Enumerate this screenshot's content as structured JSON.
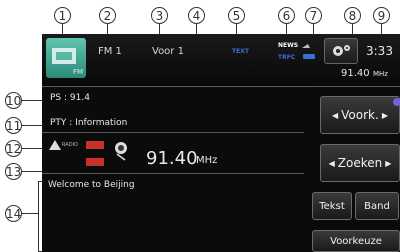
{
  "callouts": [
    "1",
    "2",
    "3",
    "4",
    "5",
    "6",
    "7",
    "8",
    "9",
    "10",
    "11",
    "12",
    "13",
    "14"
  ],
  "top": {
    "source_icon_label": "FM",
    "band": "FM  1",
    "preset": "Voor 1",
    "text_indicator": "TEXT",
    "news_indicator": "NEWS",
    "trfc_indicator": "TRFC",
    "clock": "3:33",
    "freq_value": "91.40",
    "freq_unit": "MHz"
  },
  "info": {
    "ps": "PS : 91.4",
    "pty": "PTY : Information",
    "radio_label": "RADIO",
    "freq_value": "91.40",
    "freq_unit": "MHz",
    "radio_text": "Welcome to Beijing"
  },
  "buttons": {
    "prev_next": "Voork.",
    "search": "Zoeken",
    "text": "Tekst",
    "band": "Band",
    "preset": "Voorkeuze"
  },
  "colors": {
    "screen_bg": "#111111",
    "accent_blue": "#3a6fd6",
    "signal_red": "#c8302a"
  }
}
